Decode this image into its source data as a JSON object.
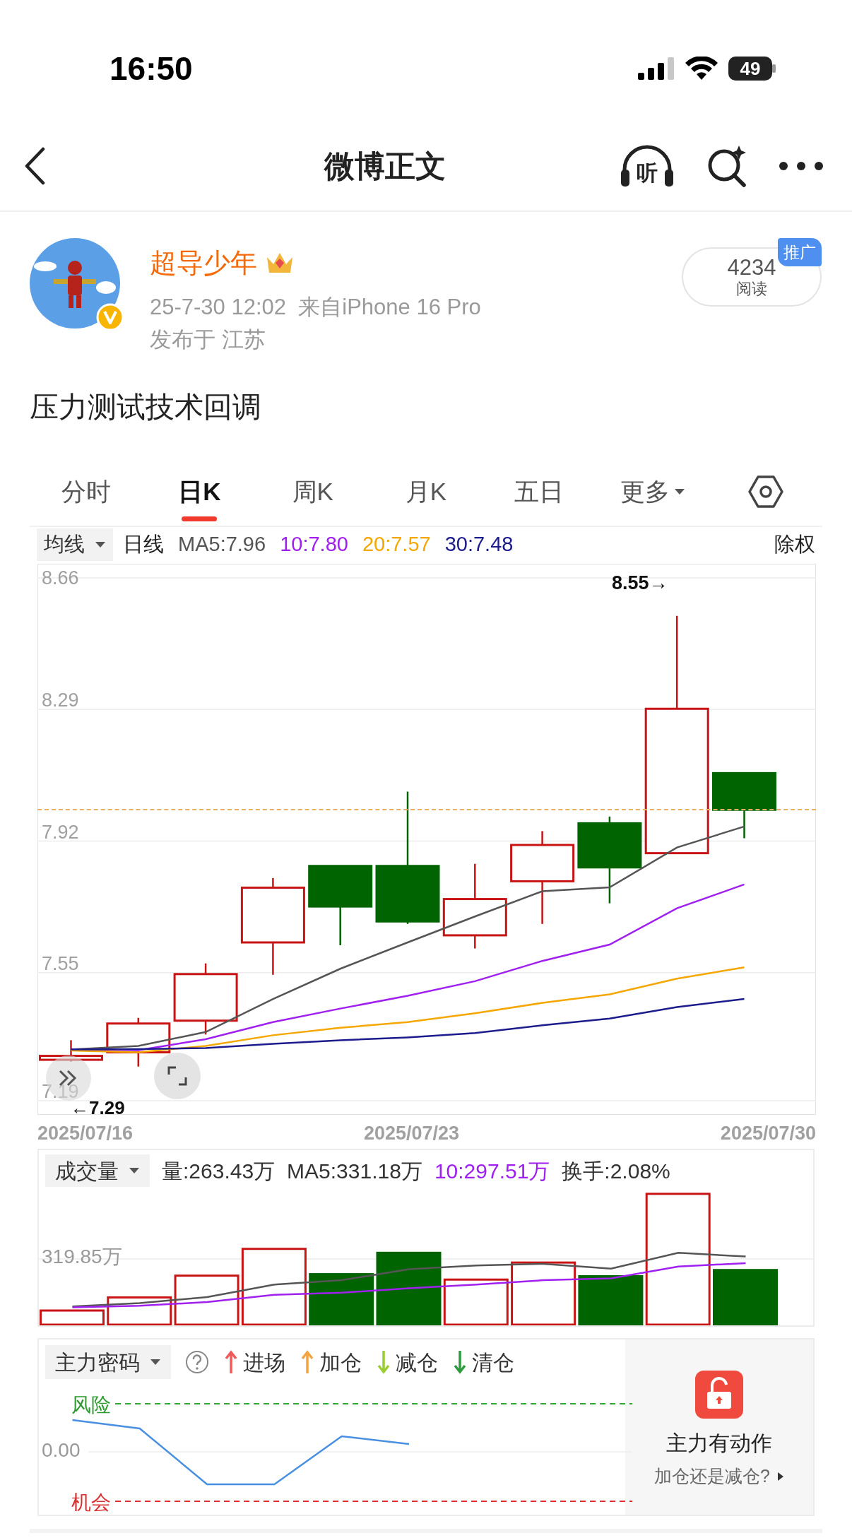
{
  "status_bar": {
    "time": "16:50",
    "battery": "49"
  },
  "nav": {
    "title": "微博正文",
    "listen_icon_text": "听"
  },
  "post": {
    "author": "超导少年",
    "verified": true,
    "meta": "25-7-30 12:02  来自iPhone 16 Pro",
    "location": "发布于 江苏",
    "reads": {
      "count": "4234",
      "label": "阅读",
      "badge": "推广"
    },
    "text": "压力测试技术回调"
  },
  "tabs": [
    {
      "label": "分时",
      "selected": false,
      "kind": "text"
    },
    {
      "label": "日K",
      "selected": true,
      "kind": "text"
    },
    {
      "label": "周K",
      "selected": false,
      "kind": "text"
    },
    {
      "label": "月K",
      "selected": false,
      "kind": "text"
    },
    {
      "label": "五日",
      "selected": false,
      "kind": "text"
    },
    {
      "label": "更多",
      "selected": false,
      "kind": "menu"
    },
    {
      "selected": false,
      "kind": "settings"
    }
  ],
  "ma_bar": {
    "selector": "均线",
    "period": "日线",
    "readings": [
      {
        "text": "MA5:7.96",
        "color": "#555555"
      },
      {
        "text": "10:7.80",
        "color": "#a020f0"
      },
      {
        "text": "20:7.57",
        "color": "#f5a700"
      },
      {
        "text": "30:7.48",
        "color": "#1c1c8c"
      }
    ],
    "adjust": "除权"
  },
  "kline": {
    "chart_data": {
      "type": "line",
      "grid": true,
      "ylim": [
        7.19,
        8.66
      ],
      "yticks": [
        7.19,
        7.55,
        7.92,
        8.29,
        8.66
      ],
      "series": [
        {
          "color": "#555555",
          "values": [
            7.334,
            7.344,
            7.383,
            7.476,
            7.561,
            7.635,
            7.708,
            7.779,
            7.79,
            7.902,
            7.961
          ]
        },
        {
          "color": "#a020f0",
          "values": [
            7.334,
            7.332,
            7.363,
            7.411,
            7.449,
            7.485,
            7.526,
            7.583,
            7.629,
            7.731,
            7.798
          ]
        },
        {
          "color": "#f5a700",
          "values": [
            7.331,
            7.326,
            7.344,
            7.374,
            7.395,
            7.411,
            7.436,
            7.465,
            7.489,
            7.533,
            7.565
          ]
        },
        {
          "color": "#1c1c8c",
          "values": [
            7.334,
            7.335,
            7.338,
            7.35,
            7.36,
            7.368,
            7.38,
            7.402,
            7.421,
            7.453,
            7.476
          ]
        }
      ],
      "annotations": [
        "8.55→",
        "←7.29"
      ]
    },
    "dates": [
      "2025/07/16",
      "2025/07/23",
      "2025/07/30"
    ]
  },
  "volume": {
    "selector": "成交量",
    "readings": [
      {
        "text": "量:263.43万",
        "color": "#333333"
      },
      {
        "text": "MA5:331.18万",
        "color": "#333333"
      },
      {
        "text": "10:297.51万",
        "color": "#a020f0"
      },
      {
        "text": "换手:2.08%",
        "color": "#333333"
      }
    ],
    "tick": "319.85万"
  },
  "main_force": {
    "selector": "主力密码",
    "legend": [
      {
        "label": "进场",
        "color": "#f05a5a",
        "kind": "up"
      },
      {
        "label": "加仓",
        "color": "#f5a340",
        "kind": "up"
      },
      {
        "label": "减仓",
        "color": "#9acd32",
        "kind": "down"
      },
      {
        "label": "清仓",
        "color": "#2e9b3e",
        "kind": "down"
      }
    ],
    "risk_label": "风险",
    "zero_label": "0.00",
    "chance_label": "机会",
    "promo": {
      "title": "主力有动作",
      "subtitle": "加仓还是减仓?"
    }
  }
}
